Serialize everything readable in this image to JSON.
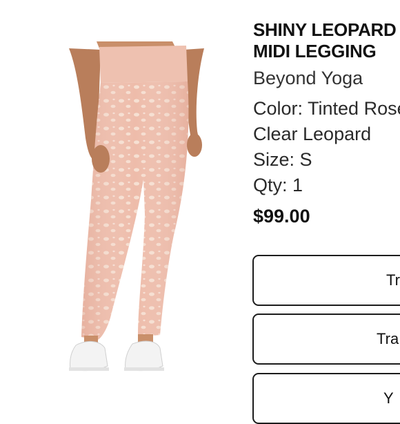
{
  "product": {
    "title_line1": "SHINY LEOPARD",
    "title_line2": "MIDI LEGGING",
    "brand": "Beyond Yoga",
    "color_line1": "Color: Tinted Rose",
    "color_line2": "Clear Leopard",
    "size": "Size: S",
    "quantity": "Qty: 1",
    "price": "$99.00"
  },
  "image": {
    "icon": "product-photo-leggings",
    "legging_color": "#eebcaa",
    "print_color": "#f7e3d6"
  },
  "actions": {
    "button1_label": "Tr",
    "button2_label": "Tra",
    "button3_label": "Y"
  }
}
